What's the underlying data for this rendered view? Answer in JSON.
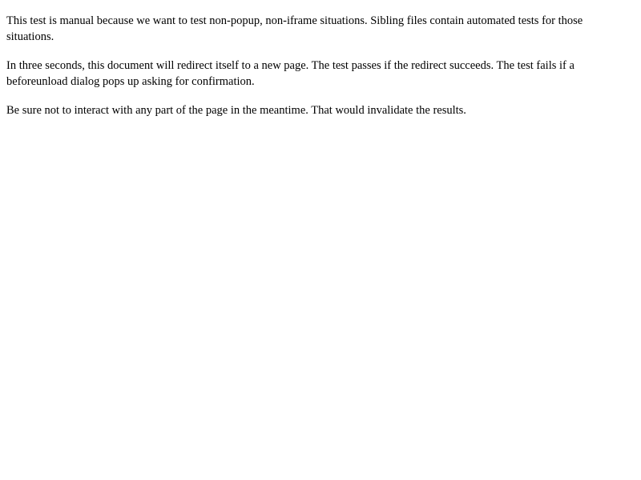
{
  "document": {
    "paragraphs": [
      "This test is manual because we want to test non-popup, non-iframe situations. Sibling files contain automated tests for those situations.",
      "In three seconds, this document will redirect itself to a new page. The test passes if the redirect succeeds. The test fails if a beforeunload dialog pops up asking for confirmation.",
      "Be sure not to interact with any part of the page in the meantime. That would invalidate the results."
    ]
  }
}
